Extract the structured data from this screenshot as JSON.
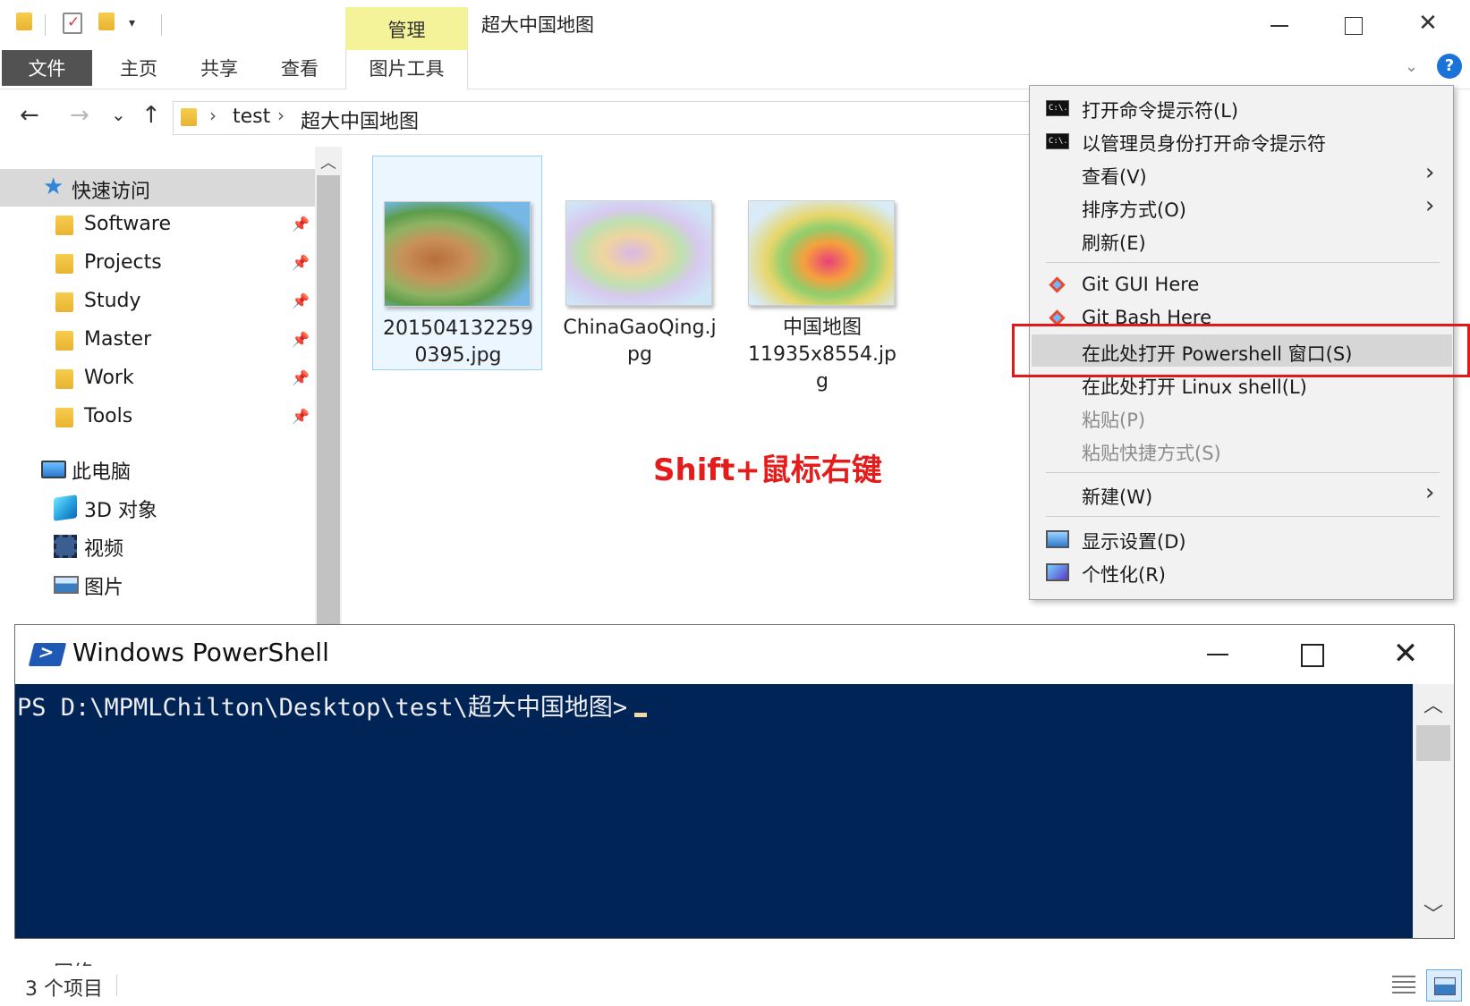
{
  "title_bar": {
    "manage_tab": "管理",
    "window_title": "超大中国地图",
    "minimize": "—",
    "maximize": "☐",
    "close": "✕"
  },
  "ribbon": {
    "tabs": [
      "文件",
      "主页",
      "共享",
      "查看",
      "图片工具"
    ],
    "help": "?"
  },
  "address": {
    "back": "←",
    "forward": "→",
    "recent": "⌄",
    "up": "↑",
    "crumbs": [
      "test",
      "超大中国地图"
    ],
    "separator": "›"
  },
  "nav": {
    "quick_access": "快速访问",
    "pinned": [
      "Software",
      "Projects",
      "Study",
      "Master",
      "Work",
      "Tools"
    ],
    "this_pc": "此电脑",
    "pc_items": [
      "3D 对象",
      "视频",
      "图片"
    ],
    "partial_item": "网络"
  },
  "files": [
    {
      "line1": "201504132259",
      "line2": "0395.jpg",
      "line3": ""
    },
    {
      "line1": "ChinaGaoQing.j",
      "line2": "pg",
      "line3": ""
    },
    {
      "line1": "中国地图",
      "line2": "11935x8554.jp",
      "line3": "g"
    }
  ],
  "annotation": "Shift+鼠标右键",
  "context_menu": {
    "items": [
      {
        "label": "打开命令提示符(L)",
        "icon": "cmd-icon"
      },
      {
        "label": "以管理员身份打开命令提示符",
        "icon": "cmd-icon"
      },
      {
        "label": "查看(V)",
        "submenu": true
      },
      {
        "label": "排序方式(O)",
        "submenu": true
      },
      {
        "label": "刷新(E)"
      },
      {
        "label": "Git GUI Here",
        "icon": "git-icon"
      },
      {
        "label": "Git Bash Here",
        "icon": "git-icon"
      },
      {
        "label": "在此处打开 Powershell 窗口(S)",
        "highlighted": true
      },
      {
        "label": "在此处打开 Linux shell(L)"
      },
      {
        "label": "粘贴(P)",
        "disabled": true
      },
      {
        "label": "粘贴快捷方式(S)",
        "disabled": true
      },
      {
        "label": "新建(W)",
        "submenu": true
      },
      {
        "label": "显示设置(D)",
        "icon": "display-icon"
      },
      {
        "label": "个性化(R)",
        "icon": "personalize-icon"
      }
    ],
    "submenu_arrow": "›",
    "cmd_icon_text": "C:\\."
  },
  "powershell": {
    "title": "Windows PowerShell",
    "prompt": "PS D:\\MPMLChilton\\Desktop\\test\\超大中国地图>",
    "close": "✕",
    "scroll_up": "⌃",
    "scroll_down": "⌄"
  },
  "status_bar": {
    "item_count": "3 个项目"
  },
  "colors": {
    "ps_background": "#012456",
    "annotation_red": "#e31c1c",
    "manage_tab_yellow": "#f5f39a",
    "file_tab_gray": "#525252",
    "selection_blue": "#99d1ff"
  }
}
